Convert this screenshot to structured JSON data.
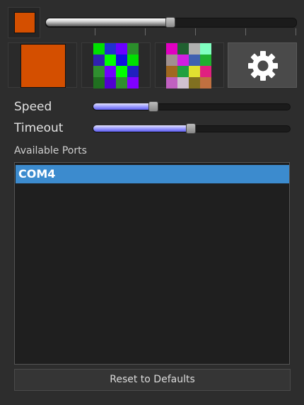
{
  "current_color": "#d44f00",
  "top_slider": {
    "value_fraction": 0.5
  },
  "tools": {
    "solid_color": "#d44f00",
    "palette_grid_1": [
      "#00e000",
      "#2030d0",
      "#6a00ff",
      "#2b8f2b",
      "#3020b0",
      "#00ff00",
      "#1010e0",
      "#00e000",
      "#2f8f2f",
      "#7000ff",
      "#00ff00",
      "#2020c0",
      "#207020",
      "#5000d0",
      "#2f8f2f",
      "#8000ff"
    ],
    "palette_grid_2": [
      "#e000c0",
      "#206030",
      "#b0b0b0",
      "#80ffc0",
      "#a09090",
      "#d020e0",
      "#4060b0",
      "#20b030",
      "#a06820",
      "#20a040",
      "#e0e030",
      "#e02080",
      "#c060c0",
      "#d0c0d0",
      "#807020",
      "#c07040"
    ],
    "settings_icon": "gear-icon"
  },
  "speed": {
    "label": "Speed",
    "value_fraction": 0.31
  },
  "timeout": {
    "label": "Timeout",
    "value_fraction": 0.5
  },
  "ports": {
    "label": "Available Ports",
    "items": [
      "COM4"
    ],
    "selected_index": 0
  },
  "reset_label": "Reset to Defaults"
}
